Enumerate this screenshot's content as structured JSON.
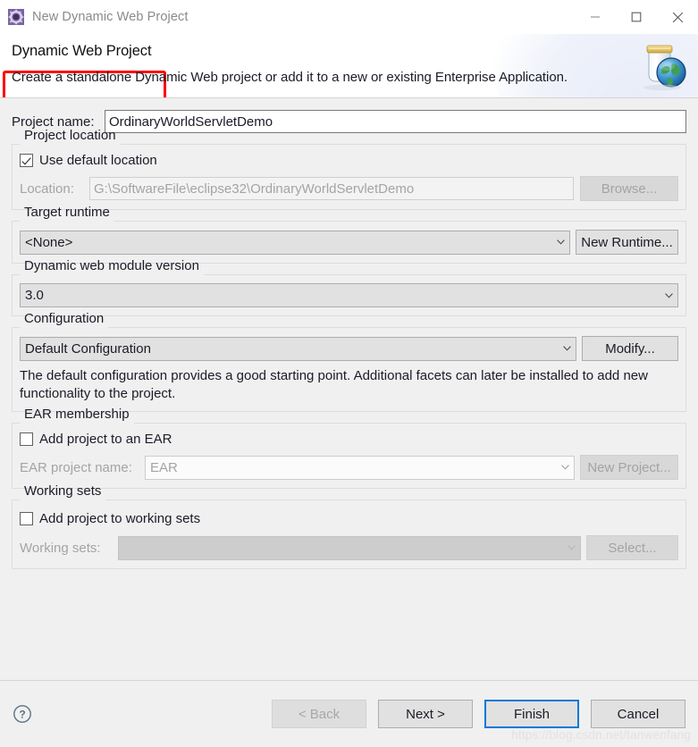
{
  "window": {
    "title": "New Dynamic Web Project",
    "icon": "eclipse-project-icon",
    "minimize_label": "—",
    "maximize_label": "□",
    "close_label": "✕"
  },
  "banner": {
    "title": "Dynamic Web Project",
    "description": "Create a standalone Dynamic Web project or add it to a new or existing Enterprise Application.",
    "icon": "web-jar-globe-icon",
    "highlight_color": "#ff0000"
  },
  "project_name": {
    "label": "Project name:",
    "value": "OrdinaryWorldServletDemo",
    "placeholder": ""
  },
  "project_location": {
    "group_title": "Project location",
    "use_default_label": "Use default location",
    "use_default_checked": true,
    "location_label": "Location:",
    "location_value": "G:\\SoftwareFile\\eclipse32\\OrdinaryWorldServletDemo",
    "browse_label": "Browse...",
    "browse_enabled": false
  },
  "target_runtime": {
    "group_title": "Target runtime",
    "value": "<None>",
    "new_runtime_label": "New Runtime...",
    "options": [
      "<None>"
    ]
  },
  "module_version": {
    "group_title": "Dynamic web module version",
    "value": "3.0",
    "options": [
      "3.0"
    ]
  },
  "configuration": {
    "group_title": "Configuration",
    "value": "Default Configuration",
    "modify_label": "Modify...",
    "description": "The default configuration provides a good starting point. Additional facets can later be installed to add new functionality to the project.",
    "options": [
      "Default Configuration"
    ]
  },
  "ear_membership": {
    "group_title": "EAR membership",
    "add_to_ear_label": "Add project to an EAR",
    "add_to_ear_checked": false,
    "ear_project_label": "EAR project name:",
    "ear_project_value": "EAR",
    "new_project_label": "New Project...",
    "new_project_enabled": false
  },
  "working_sets": {
    "group_title": "Working sets",
    "add_to_working_sets_label": "Add project to working sets",
    "add_to_working_sets_checked": false,
    "working_sets_label": "Working sets:",
    "working_sets_value": "",
    "select_label": "Select...",
    "select_enabled": false
  },
  "footer": {
    "help_icon": "help-question-icon",
    "back_label": "< Back",
    "back_enabled": false,
    "next_label": "Next >",
    "finish_label": "Finish",
    "cancel_label": "Cancel",
    "focus_color": "#0078d7"
  },
  "watermark": {
    "text": "https://blog.csdn.net/tanwenfang"
  }
}
